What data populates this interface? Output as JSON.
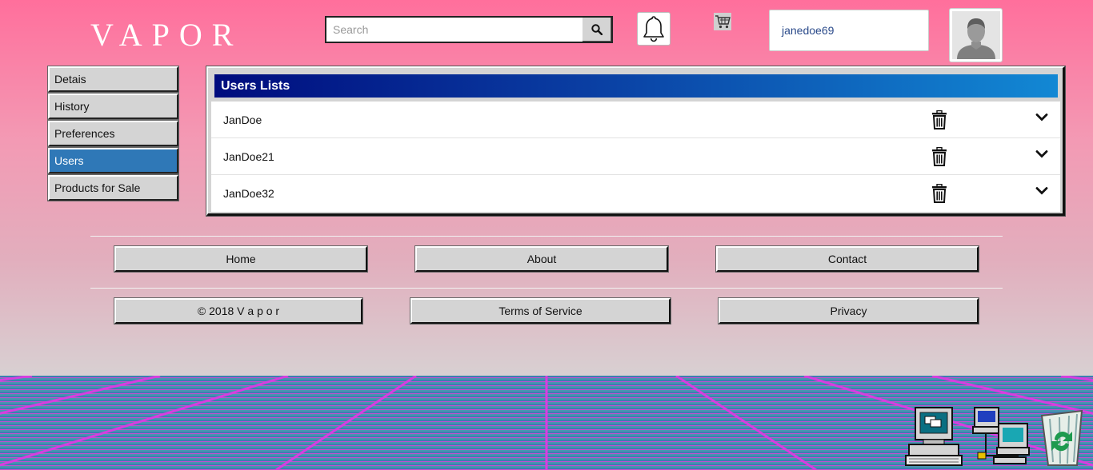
{
  "header": {
    "logo": "VAPOR",
    "search_placeholder": "Search",
    "username": "janedoe69"
  },
  "sidebar": {
    "items": [
      {
        "label": "Detais",
        "active": false
      },
      {
        "label": "History",
        "active": false
      },
      {
        "label": "Preferences",
        "active": false
      },
      {
        "label": "Users",
        "active": true
      },
      {
        "label": "Products for Sale",
        "active": false
      }
    ]
  },
  "panel": {
    "title": "Users Lists",
    "users": [
      "JanDoe",
      "JanDoe21",
      "JanDoe32"
    ]
  },
  "footer": {
    "row1": [
      "Home",
      "About",
      "Contact"
    ],
    "row2": [
      "© 2018 V a p o r",
      "Terms of Service",
      "Privacy"
    ]
  },
  "desktop_icons": [
    "my-computer-icon",
    "network-icon",
    "recycle-bin-icon"
  ],
  "colors": {
    "accent": "#2f78b7",
    "title_bar_start": "#000c7e",
    "title_bar_end": "#1288d4",
    "grid_line": "#d63ee0"
  }
}
